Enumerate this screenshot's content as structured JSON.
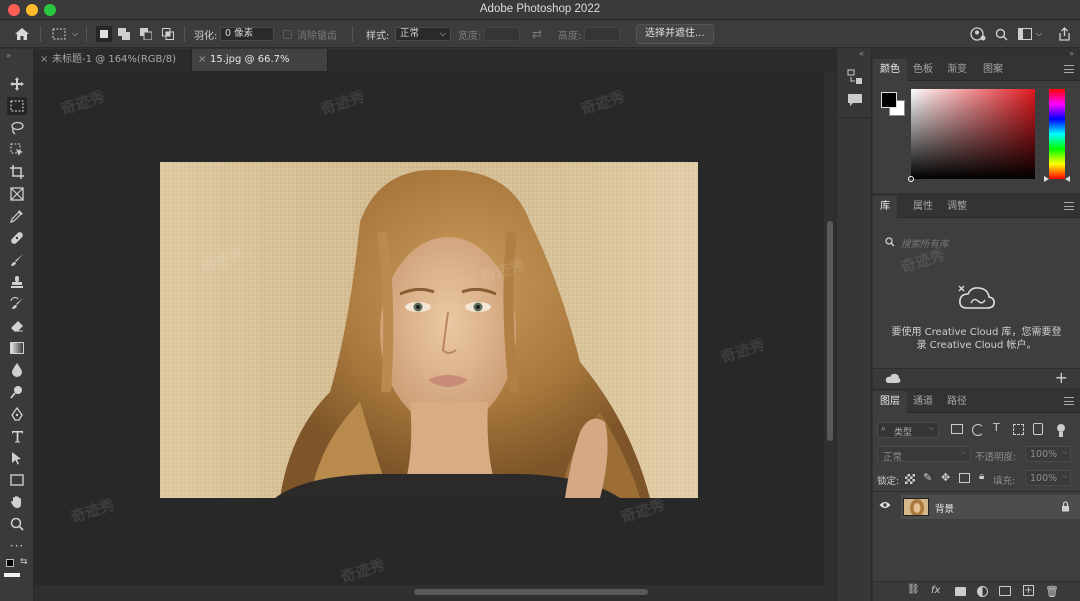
{
  "app": {
    "title": "Adobe Photoshop 2022"
  },
  "options_bar": {
    "feather_label": "羽化:",
    "feather_value": "0 像素",
    "antialias_label": "消除锯齿",
    "style_label": "样式:",
    "style_value": "正常",
    "width_label": "宽度:",
    "height_label": "高度:",
    "select_mask_button": "选择并遮住..."
  },
  "tabs": [
    {
      "label": "未标题-1 @ 164%(RGB/8)",
      "active": false
    },
    {
      "label": "15.jpg @ 66.7%(RGB/8)",
      "active": true
    }
  ],
  "color_panel": {
    "tabs": [
      "颜色",
      "色板",
      "渐变",
      "图案"
    ],
    "active_tab": "颜色",
    "hue_color": "#e0191f",
    "foreground": "#000000",
    "background": "#ffffff"
  },
  "libraries_panel": {
    "tabs": [
      "库",
      "属性",
      "调整"
    ],
    "active_tab": "库",
    "search_placeholder": "搜索所有库",
    "message_line1": "要使用 Creative Cloud 库，您需要登",
    "message_line2": "录 Creative Cloud 帐户。"
  },
  "layers_panel": {
    "tabs": [
      "图层",
      "通道",
      "路径"
    ],
    "active_tab": "图层",
    "filter_label": "类型",
    "blend_mode": "正常",
    "opacity_label": "不透明度:",
    "opacity_value": "100%",
    "lock_label": "锁定:",
    "fill_label": "填充:",
    "fill_value": "100%",
    "layers": [
      {
        "name": "背景",
        "visible": true,
        "locked": true
      }
    ]
  },
  "document": {
    "filename": "15.jpg",
    "zoom": "66.7%",
    "mode": "RGB/8"
  },
  "watermark": "奇迹秀"
}
